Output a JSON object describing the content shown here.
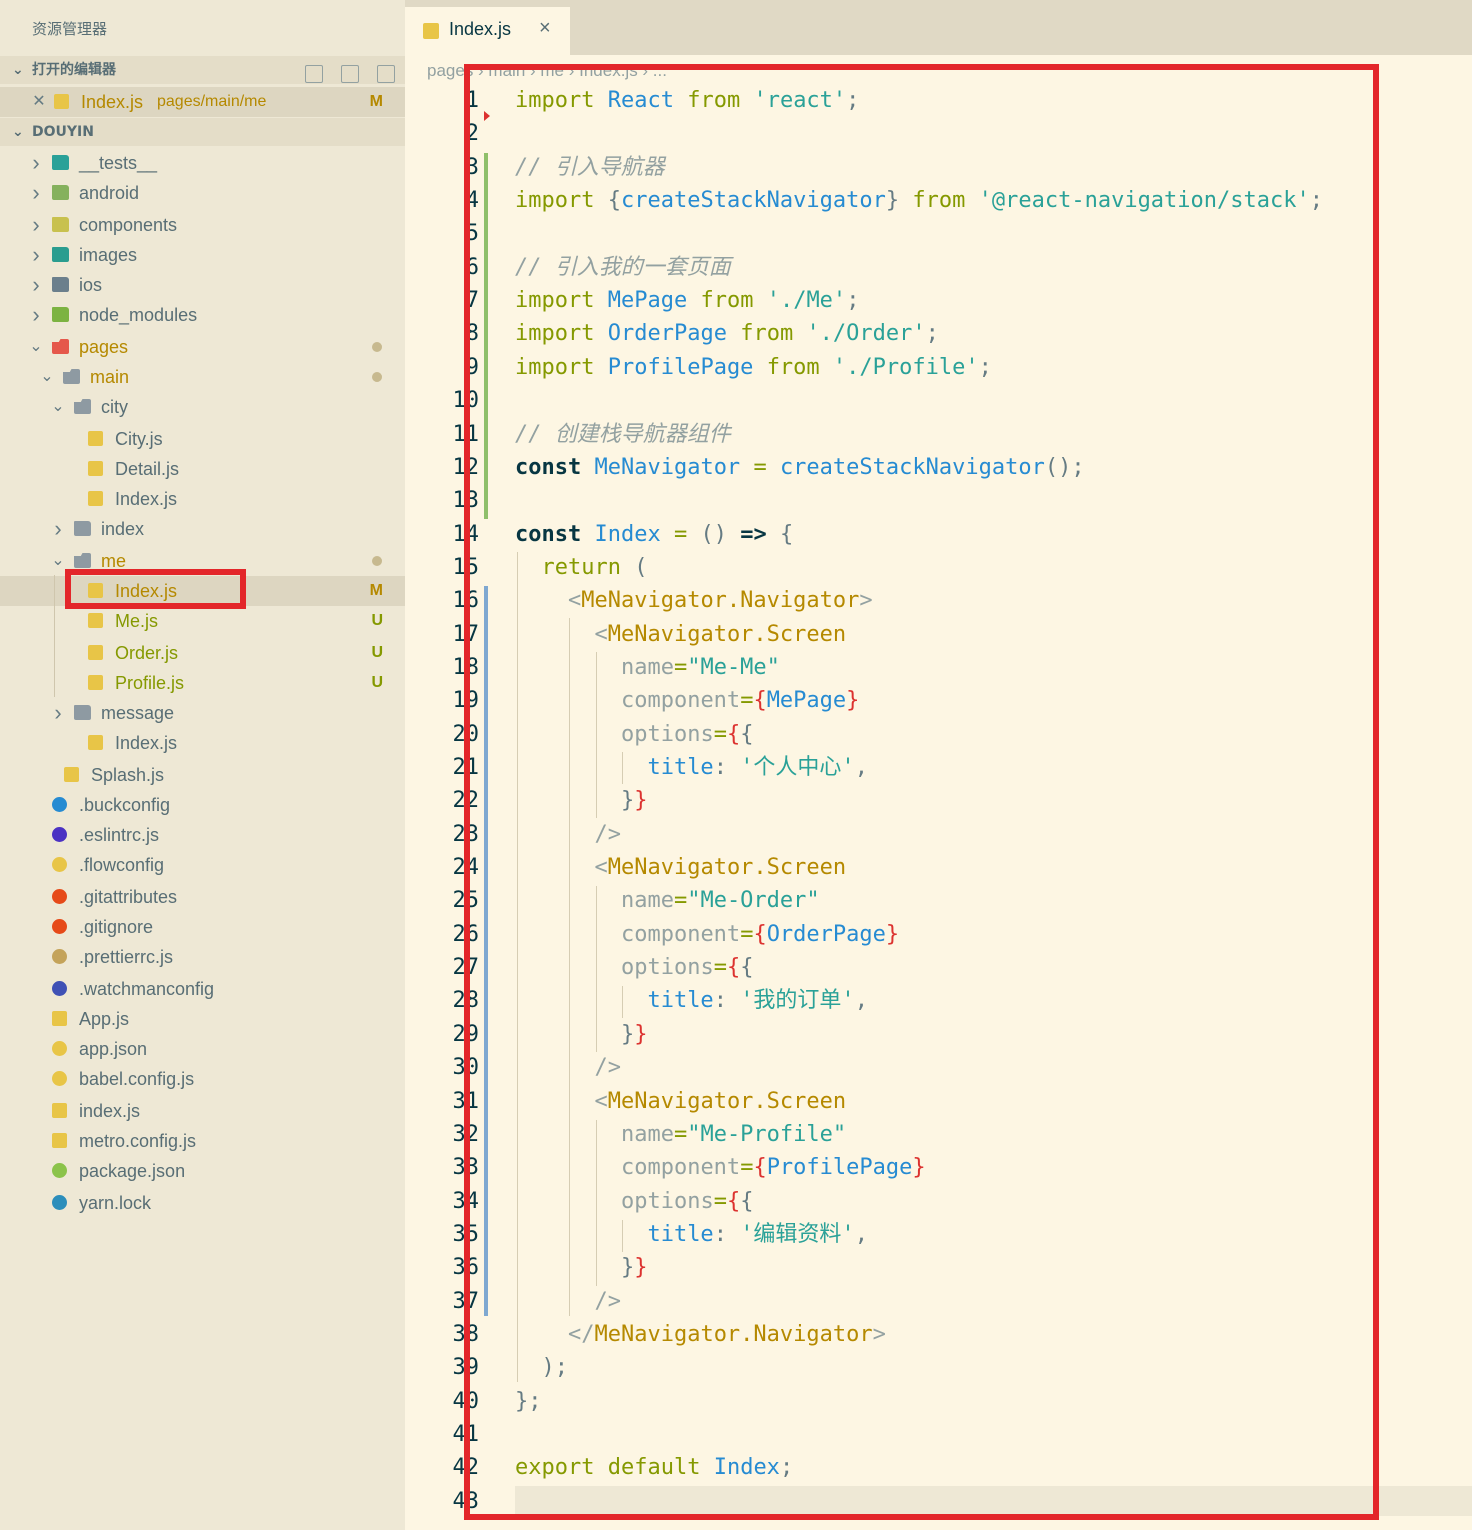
{
  "explorer": {
    "title": "资源管理器",
    "open_editors_label": "打开的编辑器",
    "open_file": {
      "name": "Index.js",
      "path": "pages/main/me",
      "badge": "M"
    },
    "project_label": "DOUYIN"
  },
  "tree": [
    {
      "name": "__tests__",
      "type": "folder",
      "depth": 0,
      "expanded": false,
      "icon_color": "#2aa198"
    },
    {
      "name": "android",
      "type": "folder",
      "depth": 0,
      "expanded": false,
      "icon_color": "#85b15d"
    },
    {
      "name": "components",
      "type": "folder",
      "depth": 0,
      "expanded": false,
      "icon_color": "#c8c14e"
    },
    {
      "name": "images",
      "type": "folder",
      "depth": 0,
      "expanded": false,
      "icon_color": "#2a9d8f"
    },
    {
      "name": "ios",
      "type": "folder",
      "depth": 0,
      "expanded": false,
      "icon_color": "#6b7f8c"
    },
    {
      "name": "node_modules",
      "type": "folder",
      "depth": 0,
      "expanded": false,
      "icon_color": "#7cb342"
    },
    {
      "name": "pages",
      "type": "folder-open",
      "depth": 0,
      "expanded": true,
      "icon_color": "#e5584b",
      "status": "dot",
      "tone": "mod"
    },
    {
      "name": "main",
      "type": "folder-open",
      "depth": 1,
      "expanded": true,
      "icon_color": "#8e9aa2",
      "status": "dot",
      "tone": "mod"
    },
    {
      "name": "city",
      "type": "folder-open",
      "depth": 2,
      "expanded": true,
      "icon_color": "#8e9aa2"
    },
    {
      "name": "City.js",
      "type": "js",
      "depth": 3
    },
    {
      "name": "Detail.js",
      "type": "js",
      "depth": 3
    },
    {
      "name": "Index.js",
      "type": "js",
      "depth": 3
    },
    {
      "name": "index",
      "type": "folder",
      "depth": 2,
      "expanded": false,
      "icon_color": "#8e9aa2"
    },
    {
      "name": "me",
      "type": "folder-open",
      "depth": 2,
      "expanded": true,
      "icon_color": "#8e9aa2",
      "status": "dot",
      "tone": "mod"
    },
    {
      "name": "Index.js",
      "type": "js",
      "depth": 3,
      "badge": "M",
      "tone": "mod",
      "selected": true
    },
    {
      "name": "Me.js",
      "type": "js",
      "depth": 3,
      "badge": "U",
      "tone": "unt"
    },
    {
      "name": "Order.js",
      "type": "js",
      "depth": 3,
      "badge": "U",
      "tone": "unt"
    },
    {
      "name": "Profile.js",
      "type": "js",
      "depth": 3,
      "badge": "U",
      "tone": "unt"
    },
    {
      "name": "message",
      "type": "folder",
      "depth": 2,
      "expanded": false,
      "icon_color": "#8e9aa2"
    },
    {
      "name": "Index.js",
      "type": "js",
      "depth": 2
    },
    {
      "name": "Splash.js",
      "type": "js",
      "depth": 1
    },
    {
      "name": ".buckconfig",
      "type": "file",
      "depth": 0,
      "icon_color": "#268bd2"
    },
    {
      "name": ".eslintrc.js",
      "type": "file",
      "depth": 0,
      "icon_color": "#4b32c3"
    },
    {
      "name": ".flowconfig",
      "type": "file",
      "depth": 0,
      "icon_color": "#e8c547"
    },
    {
      "name": ".gitattributes",
      "type": "file",
      "depth": 0,
      "icon_color": "#e64a19"
    },
    {
      "name": ".gitignore",
      "type": "file",
      "depth": 0,
      "icon_color": "#e64a19"
    },
    {
      "name": ".prettierrc.js",
      "type": "file",
      "depth": 0,
      "icon_color": "#c4a35a"
    },
    {
      "name": ".watchmanconfig",
      "type": "file",
      "depth": 0,
      "icon_color": "#3f51b5"
    },
    {
      "name": "App.js",
      "type": "js",
      "depth": 0
    },
    {
      "name": "app.json",
      "type": "file",
      "depth": 0,
      "icon_color": "#e8c547"
    },
    {
      "name": "babel.config.js",
      "type": "file",
      "depth": 0,
      "icon_color": "#e8c547"
    },
    {
      "name": "index.js",
      "type": "js",
      "depth": 0
    },
    {
      "name": "metro.config.js",
      "type": "js",
      "depth": 0
    },
    {
      "name": "package.json",
      "type": "file",
      "depth": 0,
      "icon_color": "#8bc34a"
    },
    {
      "name": "yarn.lock",
      "type": "file",
      "depth": 0,
      "icon_color": "#2c8ebb"
    }
  ],
  "editor": {
    "tab_label": "Index.js",
    "breadcrumb": "pages › main › me › Index.js › ...",
    "lines": [
      [
        [
          "kw",
          "import"
        ],
        [
          "pu",
          " "
        ],
        [
          "id",
          "React"
        ],
        [
          "pu",
          " "
        ],
        [
          "kw",
          "from"
        ],
        [
          "pu",
          " "
        ],
        [
          "st",
          "'react'"
        ],
        [
          "pu",
          ";"
        ]
      ],
      [],
      [
        [
          "cm",
          "// 引入导航器"
        ]
      ],
      [
        [
          "kw",
          "import"
        ],
        [
          "pu",
          " {"
        ],
        [
          "id",
          "createStackNavigator"
        ],
        [
          "pu",
          "} "
        ],
        [
          "kw",
          "from"
        ],
        [
          "pu",
          " "
        ],
        [
          "st",
          "'@react-navigation/stack'"
        ],
        [
          "pu",
          ";"
        ]
      ],
      [],
      [
        [
          "cm",
          "// 引入我的一套页面"
        ]
      ],
      [
        [
          "kw",
          "import"
        ],
        [
          "pu",
          " "
        ],
        [
          "id",
          "MePage"
        ],
        [
          "pu",
          " "
        ],
        [
          "kw",
          "from"
        ],
        [
          "pu",
          " "
        ],
        [
          "st",
          "'./Me'"
        ],
        [
          "pu",
          ";"
        ]
      ],
      [
        [
          "kw",
          "import"
        ],
        [
          "pu",
          " "
        ],
        [
          "id",
          "OrderPage"
        ],
        [
          "pu",
          " "
        ],
        [
          "kw",
          "from"
        ],
        [
          "pu",
          " "
        ],
        [
          "st",
          "'./Order'"
        ],
        [
          "pu",
          ";"
        ]
      ],
      [
        [
          "kw",
          "import"
        ],
        [
          "pu",
          " "
        ],
        [
          "id",
          "ProfilePage"
        ],
        [
          "pu",
          " "
        ],
        [
          "kw",
          "from"
        ],
        [
          "pu",
          " "
        ],
        [
          "st",
          "'./Profile'"
        ],
        [
          "pu",
          ";"
        ]
      ],
      [],
      [
        [
          "cm",
          "// 创建栈导航器组件"
        ]
      ],
      [
        [
          "kb",
          "const"
        ],
        [
          "pu",
          " "
        ],
        [
          "id",
          "MeNavigator"
        ],
        [
          "pu",
          " "
        ],
        [
          "kw",
          "="
        ],
        [
          "pu",
          " "
        ],
        [
          "id",
          "createStackNavigator"
        ],
        [
          "pu",
          "();"
        ]
      ],
      [],
      [
        [
          "kb",
          "const"
        ],
        [
          "pu",
          " "
        ],
        [
          "id",
          "Index"
        ],
        [
          "pu",
          " "
        ],
        [
          "kw",
          "="
        ],
        [
          "pu",
          " () "
        ],
        [
          "kb",
          "=>"
        ],
        [
          "pu",
          " {"
        ]
      ],
      [
        [
          "pu",
          "  "
        ],
        [
          "kw",
          "return"
        ],
        [
          "pu",
          " ("
        ]
      ],
      [
        [
          "pu",
          "    "
        ],
        [
          "at",
          "<"
        ],
        [
          "tg",
          "MeNavigator.Navigator"
        ],
        [
          "at",
          ">"
        ]
      ],
      [
        [
          "pu",
          "      "
        ],
        [
          "at",
          "<"
        ],
        [
          "tg",
          "MeNavigator.Screen"
        ]
      ],
      [
        [
          "pu",
          "        "
        ],
        [
          "at",
          "name"
        ],
        [
          "kw",
          "="
        ],
        [
          "st",
          "\"Me-Me\""
        ]
      ],
      [
        [
          "pu",
          "        "
        ],
        [
          "at",
          "component"
        ],
        [
          "kw",
          "="
        ],
        [
          "br",
          "{"
        ],
        [
          "id",
          "MePage"
        ],
        [
          "br",
          "}"
        ]
      ],
      [
        [
          "pu",
          "        "
        ],
        [
          "at",
          "options"
        ],
        [
          "kw",
          "="
        ],
        [
          "br",
          "{"
        ],
        [
          "pu",
          "{"
        ]
      ],
      [
        [
          "pu",
          "          "
        ],
        [
          "id",
          "title"
        ],
        [
          "pu",
          ": "
        ],
        [
          "st",
          "'个人中心'"
        ],
        [
          "pu",
          ","
        ]
      ],
      [
        [
          "pu",
          "        }"
        ],
        [
          "br",
          "}"
        ]
      ],
      [
        [
          "pu",
          "      "
        ],
        [
          "at",
          "/>"
        ]
      ],
      [
        [
          "pu",
          "      "
        ],
        [
          "at",
          "<"
        ],
        [
          "tg",
          "MeNavigator.Screen"
        ]
      ],
      [
        [
          "pu",
          "        "
        ],
        [
          "at",
          "name"
        ],
        [
          "kw",
          "="
        ],
        [
          "st",
          "\"Me-Order\""
        ]
      ],
      [
        [
          "pu",
          "        "
        ],
        [
          "at",
          "component"
        ],
        [
          "kw",
          "="
        ],
        [
          "br",
          "{"
        ],
        [
          "id",
          "OrderPage"
        ],
        [
          "br",
          "}"
        ]
      ],
      [
        [
          "pu",
          "        "
        ],
        [
          "at",
          "options"
        ],
        [
          "kw",
          "="
        ],
        [
          "br",
          "{"
        ],
        [
          "pu",
          "{"
        ]
      ],
      [
        [
          "pu",
          "          "
        ],
        [
          "id",
          "title"
        ],
        [
          "pu",
          ": "
        ],
        [
          "st",
          "'我的订单'"
        ],
        [
          "pu",
          ","
        ]
      ],
      [
        [
          "pu",
          "        }"
        ],
        [
          "br",
          "}"
        ]
      ],
      [
        [
          "pu",
          "      "
        ],
        [
          "at",
          "/>"
        ]
      ],
      [
        [
          "pu",
          "      "
        ],
        [
          "at",
          "<"
        ],
        [
          "tg",
          "MeNavigator.Screen"
        ]
      ],
      [
        [
          "pu",
          "        "
        ],
        [
          "at",
          "name"
        ],
        [
          "kw",
          "="
        ],
        [
          "st",
          "\"Me-Profile\""
        ]
      ],
      [
        [
          "pu",
          "        "
        ],
        [
          "at",
          "component"
        ],
        [
          "kw",
          "="
        ],
        [
          "br",
          "{"
        ],
        [
          "id",
          "ProfilePage"
        ],
        [
          "br",
          "}"
        ]
      ],
      [
        [
          "pu",
          "        "
        ],
        [
          "at",
          "options"
        ],
        [
          "kw",
          "="
        ],
        [
          "br",
          "{"
        ],
        [
          "pu",
          "{"
        ]
      ],
      [
        [
          "pu",
          "          "
        ],
        [
          "id",
          "title"
        ],
        [
          "pu",
          ": "
        ],
        [
          "st",
          "'编辑资料'"
        ],
        [
          "pu",
          ","
        ]
      ],
      [
        [
          "pu",
          "        }"
        ],
        [
          "br",
          "}"
        ]
      ],
      [
        [
          "pu",
          "      "
        ],
        [
          "at",
          "/>"
        ]
      ],
      [
        [
          "pu",
          "    "
        ],
        [
          "at",
          "</"
        ],
        [
          "tg",
          "MeNavigator.Navigator"
        ],
        [
          "at",
          ">"
        ]
      ],
      [
        [
          "pu",
          "  );"
        ]
      ],
      [
        [
          "pu",
          "};"
        ]
      ],
      [],
      [
        [
          "kw",
          "export"
        ],
        [
          "pu",
          " "
        ],
        [
          "kw",
          "default"
        ],
        [
          "pu",
          " "
        ],
        [
          "id",
          "Index"
        ],
        [
          "pu",
          ";"
        ]
      ],
      []
    ]
  },
  "colors": {
    "accent_red": "#e3262a",
    "modified": "#b58900",
    "untracked": "#859900"
  }
}
